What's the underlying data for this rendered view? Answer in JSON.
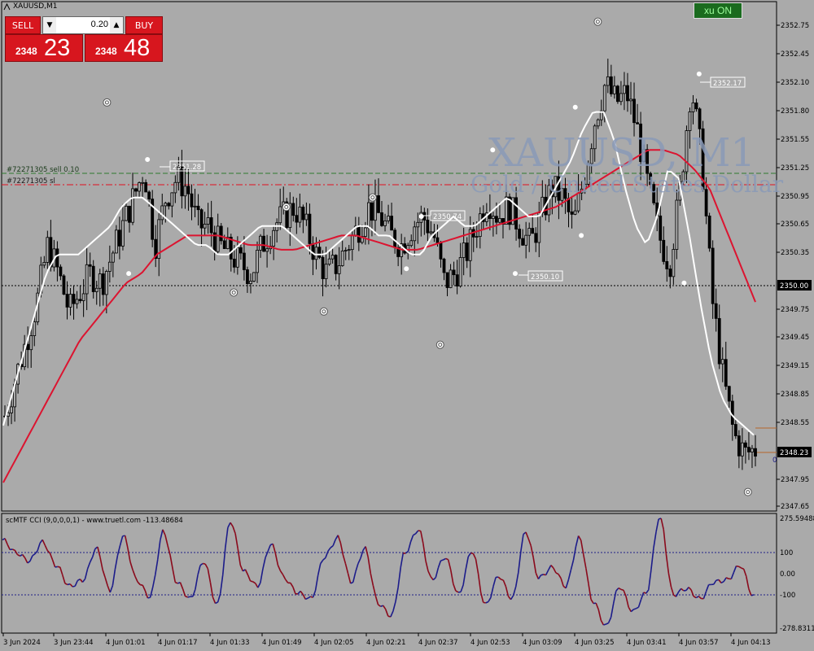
{
  "window": {
    "title": "XAUUSD,M1"
  },
  "trade_panel": {
    "sell_label": "SELL",
    "buy_label": "BUY",
    "lot_value": "0.20",
    "sell_price_small": "2348",
    "sell_price_big": "23",
    "buy_price_small": "2348",
    "buy_price_big": "48"
  },
  "indicator_button": {
    "label": "xu ON"
  },
  "watermark": {
    "symbol": "XAUUSD, M1",
    "description": "Gold / United States Dollar"
  },
  "order_lines": {
    "sell_order": "#72271305 sell 0.10",
    "sl_order": "#72271305 sl"
  },
  "price_axis": {
    "ticks": [
      "2352.75",
      "2352.45",
      "2352.10",
      "2351.80",
      "2351.55",
      "2351.25",
      "2350.95",
      "2350.65",
      "2350.35",
      "2350.05",
      "2349.75",
      "2349.45",
      "2349.15",
      "2348.85",
      "2348.55",
      "2348.25",
      "2347.95",
      "2347.65"
    ],
    "level_label": "2350.00",
    "current_label": "2348.23",
    "side_mark": "0"
  },
  "price_labels": [
    "2351.28",
    "2350.74",
    "2350.10",
    "2352.17"
  ],
  "indicator": {
    "title": "scMTF CCI (9,0,0,0,1) - www.truetl.com -113.48684",
    "axis_ticks": [
      "275.59488",
      "100",
      "0.00",
      "-100",
      "-278.83116"
    ]
  },
  "time_axis": {
    "labels": [
      "3 Jun 2024",
      "3 Jun 23:44",
      "4 Jun 01:01",
      "4 Jun 01:17",
      "4 Jun 01:33",
      "4 Jun 01:49",
      "4 Jun 02:05",
      "4 Jun 02:21",
      "4 Jun 02:37",
      "4 Jun 02:53",
      "4 Jun 03:09",
      "4 Jun 03:25",
      "4 Jun 03:41",
      "4 Jun 03:57",
      "4 Jun 04:13"
    ]
  },
  "chart_data": {
    "type": "candlestick",
    "symbol": "XAUUSD",
    "timeframe": "M1",
    "y_range": [
      2347.6,
      2352.85
    ],
    "close_path": [
      2348.6,
      2349.0,
      2349.4,
      2349.8,
      2350.4,
      2350.1,
      2349.7,
      2349.9,
      2350.1,
      2350.0,
      2350.3,
      2350.6,
      2350.9,
      2351.2,
      2350.4,
      2350.9,
      2351.1,
      2351.0,
      2350.6,
      2350.6,
      2350.4,
      2350.3,
      2350.2,
      2350.1,
      2350.4,
      2350.6,
      2350.7,
      2350.8,
      2350.6,
      2350.3,
      2350.1,
      2350.2,
      2350.4,
      2350.6,
      2350.8,
      2350.7,
      2350.5,
      2350.4,
      2350.6,
      2350.7,
      2350.5,
      2350.0,
      2350.1,
      2350.3,
      2350.6,
      2350.9,
      2350.7,
      2350.8,
      2350.6,
      2350.4,
      2350.7,
      2351.0,
      2350.9,
      2350.6,
      2351.1,
      2351.7,
      2352.1,
      2351.9,
      2352.0,
      2351.6,
      2351.0,
      2350.5,
      2350.2,
      2351.0,
      2352.1,
      2351.3,
      2349.8,
      2349.0,
      2348.4,
      2348.2,
      2348.25
    ],
    "ma_fast_path": [
      2348.5,
      2348.9,
      2349.3,
      2349.7,
      2350.1,
      2350.3,
      2350.3,
      2350.3,
      2350.4,
      2350.5,
      2350.6,
      2350.8,
      2350.9,
      2350.9,
      2350.8,
      2350.7,
      2350.6,
      2350.5,
      2350.4,
      2350.4,
      2350.3,
      2350.3,
      2350.4,
      2350.5,
      2350.6,
      2350.6,
      2350.6,
      2350.5,
      2350.4,
      2350.3,
      2350.3,
      2350.4,
      2350.5,
      2350.6,
      2350.6,
      2350.5,
      2350.5,
      2350.4,
      2350.3,
      2350.3,
      2350.5,
      2350.6,
      2350.7,
      2350.6,
      2350.6,
      2350.7,
      2350.8,
      2350.9,
      2350.8,
      2350.7,
      2350.7,
      2350.9,
      2351.1,
      2351.3,
      2351.6,
      2351.8,
      2351.8,
      2351.5,
      2351.0,
      2350.6,
      2350.4,
      2350.7,
      2351.2,
      2351.1,
      2350.5,
      2349.8,
      2349.2,
      2348.8,
      2348.6,
      2348.5,
      2348.4
    ],
    "ma_slow_path": [
      2347.9,
      2348.2,
      2348.5,
      2348.8,
      2349.1,
      2349.4,
      2349.6,
      2349.8,
      2350.0,
      2350.1,
      2350.3,
      2350.4,
      2350.5,
      2350.5,
      2350.5,
      2350.45,
      2350.4,
      2350.4,
      2350.35,
      2350.35,
      2350.4,
      2350.45,
      2350.5,
      2350.5,
      2350.45,
      2350.4,
      2350.35,
      2350.35,
      2350.4,
      2350.45,
      2350.5,
      2350.55,
      2350.6,
      2350.65,
      2350.7,
      2350.75,
      2350.8,
      2350.9,
      2351.0,
      2351.1,
      2351.2,
      2351.3,
      2351.4,
      2351.4,
      2351.35,
      2351.2,
      2351.0,
      2350.6,
      2350.2,
      2349.8
    ],
    "cci_series": [
      160,
      100,
      60,
      150,
      40,
      -60,
      -30,
      120,
      -80,
      180,
      -30,
      -110,
      200,
      -40,
      -120,
      60,
      -150,
      250,
      10,
      -60,
      140,
      -20,
      -90,
      -120,
      80,
      170,
      -40,
      120,
      -140,
      -200,
      100,
      210,
      -30,
      80,
      -100,
      110,
      -150,
      -10,
      -120,
      200,
      -20,
      30,
      -60,
      170,
      -130,
      -250,
      -60,
      -180,
      -90,
      275,
      -100,
      -70,
      -120,
      -40,
      -30,
      40,
      -110
    ]
  }
}
